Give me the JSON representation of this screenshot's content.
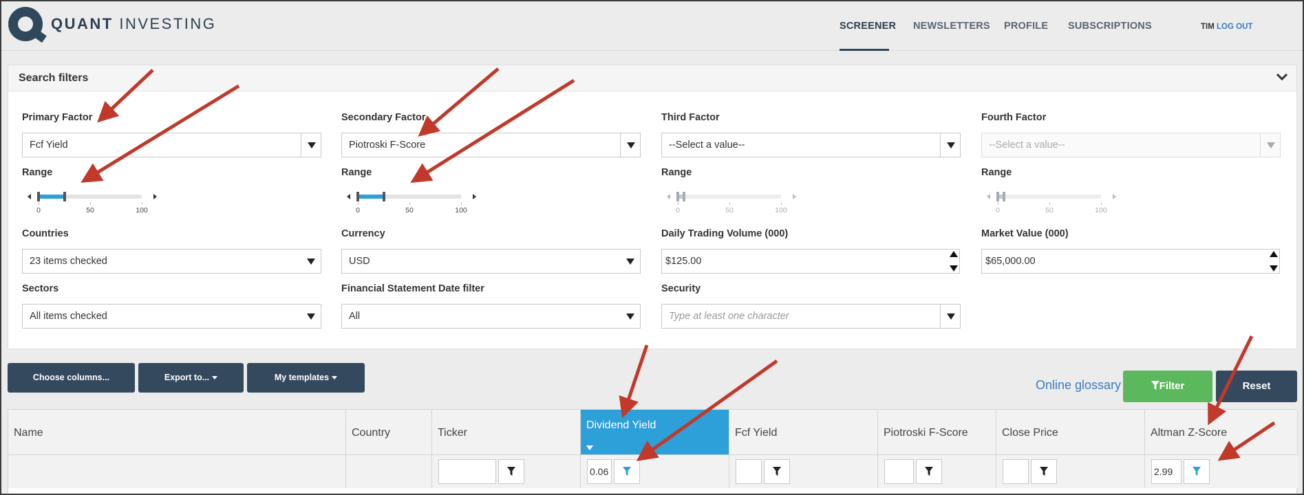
{
  "brand": {
    "name_bold": "QUANT",
    "name_rest": " INVESTING"
  },
  "nav": {
    "screener": "SCREENER",
    "newsletters": "NEWSLETTERS",
    "profile": "PROFILE",
    "subscriptions": "SUBSCRIPTIONS"
  },
  "user": {
    "name": "TIM",
    "logout": "LOG OUT"
  },
  "panel": {
    "title": "Search filters"
  },
  "filters": {
    "primary": {
      "label": "Primary Factor",
      "value": "Fcf Yield",
      "range_label": "Range"
    },
    "secondary": {
      "label": "Secondary Factor",
      "value": "Piotroski F-Score",
      "range_label": "Range"
    },
    "third": {
      "label": "Third Factor",
      "value": "--Select a value--",
      "range_label": "Range"
    },
    "fourth": {
      "label": "Fourth Factor",
      "value": "--Select a value--",
      "range_label": "Range"
    },
    "countries": {
      "label": "Countries",
      "value": "23 items checked"
    },
    "currency": {
      "label": "Currency",
      "value": "USD"
    },
    "volume": {
      "label": "Daily Trading Volume (000)",
      "value": "$125.00"
    },
    "market_value": {
      "label": "Market Value (000)",
      "value": "$65,000.00"
    },
    "sectors": {
      "label": "Sectors",
      "value": "All items checked"
    },
    "fs_date": {
      "label": "Financial Statement Date filter",
      "value": "All"
    },
    "security": {
      "label": "Security",
      "placeholder": "Type at least one character"
    }
  },
  "slider_ticks": [
    "0",
    "50",
    "100"
  ],
  "sliders": {
    "primary": {
      "low": 0,
      "high": 25,
      "enabled": true
    },
    "secondary": {
      "low": 0,
      "high": 25,
      "enabled": true
    },
    "third": {
      "low": 0,
      "high": 6,
      "enabled": false
    },
    "fourth": {
      "low": 0,
      "high": 6,
      "enabled": false
    }
  },
  "toolbar": {
    "choose_columns": "Choose columns...",
    "export": "Export to...",
    "templates": "My templates",
    "glossary": "Online glossary",
    "filter": "Filter",
    "reset": "Reset"
  },
  "table": {
    "columns": [
      "Name",
      "Country",
      "Ticker",
      "Dividend Yield",
      "Fcf Yield",
      "Piotroski F-Score",
      "Close Price",
      "Altman Z-Score"
    ],
    "filters": {
      "dividend_yield": "0.06",
      "altman_z": "2.99"
    }
  },
  "colors": {
    "accent": "#2d9fd9",
    "navy": "#34495e",
    "green": "#5cb85c",
    "arrow": "#c0392b"
  }
}
